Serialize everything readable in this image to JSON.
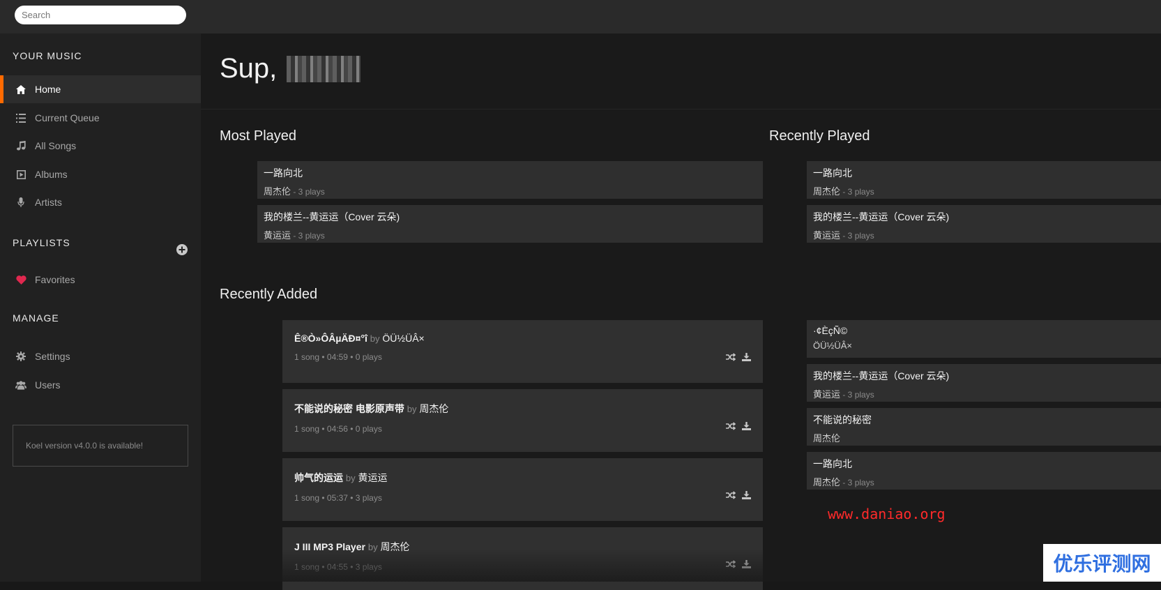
{
  "search": {
    "placeholder": "Search"
  },
  "sidebar": {
    "your_music_title": "YOUR MUSIC",
    "items": [
      {
        "label": "Home",
        "icon": "home-icon",
        "active": true
      },
      {
        "label": "Current Queue",
        "icon": "list-icon"
      },
      {
        "label": "All Songs",
        "icon": "music-note-icon"
      },
      {
        "label": "Albums",
        "icon": "album-icon"
      },
      {
        "label": "Artists",
        "icon": "microphone-icon"
      }
    ],
    "playlists_title": "PLAYLISTS",
    "playlists": [
      {
        "label": "Favorites",
        "icon": "heart-icon"
      }
    ],
    "manage_title": "MANAGE",
    "manage": [
      {
        "label": "Settings",
        "icon": "gear-icon"
      },
      {
        "label": "Users",
        "icon": "users-icon"
      }
    ],
    "notice": "Koel version v4.0.0 is available!"
  },
  "main": {
    "greeting": "Sup,",
    "most_played": {
      "title": "Most Played",
      "songs": [
        {
          "title": "一路向北",
          "artist": "周杰伦",
          "plays": " - 3 plays"
        },
        {
          "title": "我的楼兰--黄运运（Cover 云朵)",
          "artist": "黄运运",
          "plays": " - 3 plays"
        }
      ]
    },
    "recently_played": {
      "title": "Recently Played",
      "songs": [
        {
          "title": "一路向北",
          "artist": "周杰伦",
          "plays": " - 3 plays"
        },
        {
          "title": "我的楼兰--黄运运（Cover 云朵)",
          "artist": "黄运运",
          "plays": " - 3 plays"
        }
      ]
    },
    "recently_added": {
      "title": "Recently Added",
      "albums": [
        {
          "name": "Ê®Ò»ÔÂµÄÐ¤°î",
          "by": "by",
          "artist": "ÖÜ½ÜÂ×",
          "meta": "1 song • 04:59 • 0 plays"
        },
        {
          "name": "不能说的秘密 电影原声带",
          "by": "by",
          "artist": "周杰伦",
          "meta": "1 song • 04:56 • 0 plays"
        },
        {
          "name": "帅气的运运",
          "by": "by",
          "artist": "黄运运",
          "meta": "1 song • 05:37 • 3 plays"
        },
        {
          "name": "J III MP3 Player",
          "by": "by",
          "artist": "周杰伦",
          "meta": "1 song • 04:55 • 3 plays"
        }
      ],
      "songs": [
        {
          "title": "·¢ÈçÑ©",
          "artist": "ÖÜ½ÜÂ×",
          "plays": ""
        },
        {
          "title": "我的楼兰--黄运运（Cover 云朵)",
          "artist": "黄运运",
          "plays": " - 3 plays"
        },
        {
          "title": "不能说的秘密",
          "artist": "周杰伦",
          "plays": ""
        },
        {
          "title": "一路向北",
          "artist": "周杰伦",
          "plays": " - 3 plays"
        }
      ]
    }
  },
  "watermark": "www.daniao.org",
  "corner_logo": "优乐评测网",
  "colors": {
    "accent": "#ff6a00",
    "heart": "#e0284f",
    "watermark": "#ff2a2a"
  }
}
